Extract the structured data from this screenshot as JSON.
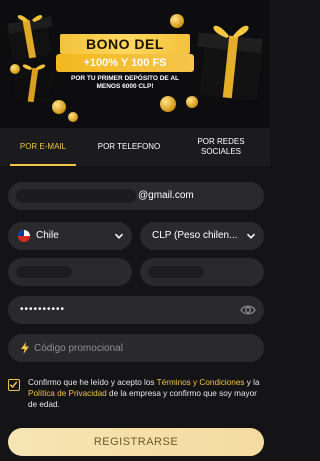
{
  "banner": {
    "title": "BONO DEL",
    "amount": "+100% Y 100 FS",
    "subtitle": "POR TU PRIMER DEPÓSITO DE AL MENOS 6000 CLP!"
  },
  "tabs": [
    {
      "label": "POR E-MAIL",
      "active": true
    },
    {
      "label": "POR TELEFONO",
      "active": false
    },
    {
      "label": "POR REDES SOCIALES",
      "active": false
    }
  ],
  "form": {
    "email_value": "@gmail.com",
    "country_value": "Chile",
    "currency_value": "CLP (Peso chilen...",
    "password_value": "••••••••••",
    "promo_placeholder": "Código promocional"
  },
  "consent": {
    "text_before": "Confirmo que he leído y acepto los ",
    "terms_link": "Términos y Condiciones",
    "text_middle": " y la ",
    "privacy_link": "Política de Privacidad",
    "text_after": " de la empresa y confirmo que soy mayor de edad.",
    "checked": true
  },
  "submit_label": "REGISTRARSE",
  "colors": {
    "accent": "#f0c54a",
    "background": "#141416",
    "field": "#2a2a2e",
    "button": "#f4dca0"
  }
}
